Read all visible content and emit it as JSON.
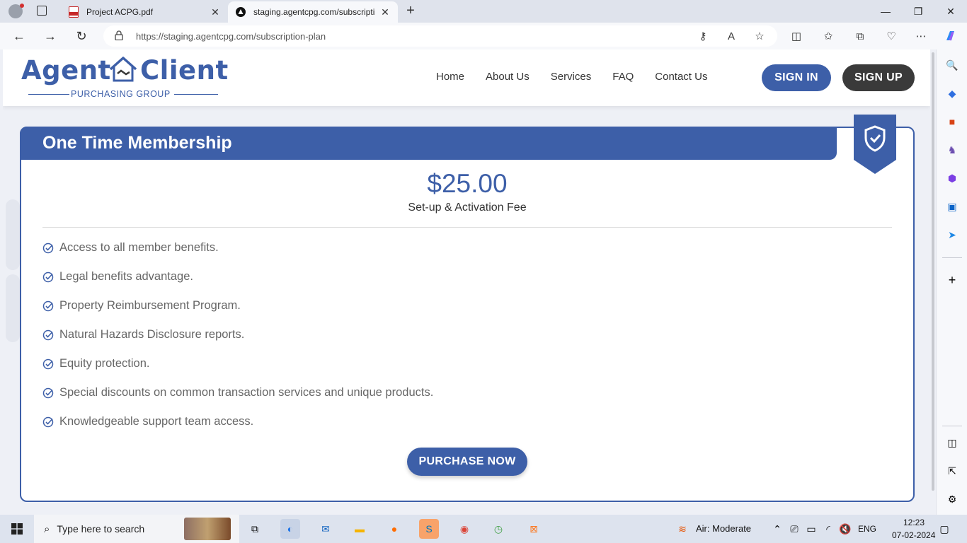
{
  "browser": {
    "tabs": [
      {
        "title": "Project ACPG.pdf",
        "active": false
      },
      {
        "title": "staging.agentcpg.com/subscripti",
        "active": true
      }
    ],
    "url": "https://staging.agentcpg.com/subscription-plan"
  },
  "site": {
    "logo": {
      "word1": "Agent",
      "word2": "Client",
      "tagline": "PURCHASING GROUP"
    },
    "nav": [
      "Home",
      "About Us",
      "Services",
      "FAQ",
      "Contact Us"
    ],
    "sign_in": "SIGN IN",
    "sign_up": "SIGN UP"
  },
  "plan": {
    "title": "One Time Membership",
    "price": "$25.00",
    "price_note": "Set-up & Activation Fee",
    "features": [
      "Access to all member benefits.",
      "Legal benefits advantage.",
      "Property Reimbursement Program.",
      "Natural Hazards Disclosure reports.",
      "Equity protection.",
      "Special discounts on common transaction services and unique products.",
      "Knowledgeable support team access."
    ],
    "cta": "PURCHASE NOW"
  },
  "taskbar": {
    "search_placeholder": "Type here to search",
    "weather": "Air: Moderate",
    "lang": "ENG",
    "time": "12:23",
    "date": "07-02-2024"
  },
  "colors": {
    "brand": "#3d5fa8",
    "dark_button": "#3a3a3a"
  }
}
